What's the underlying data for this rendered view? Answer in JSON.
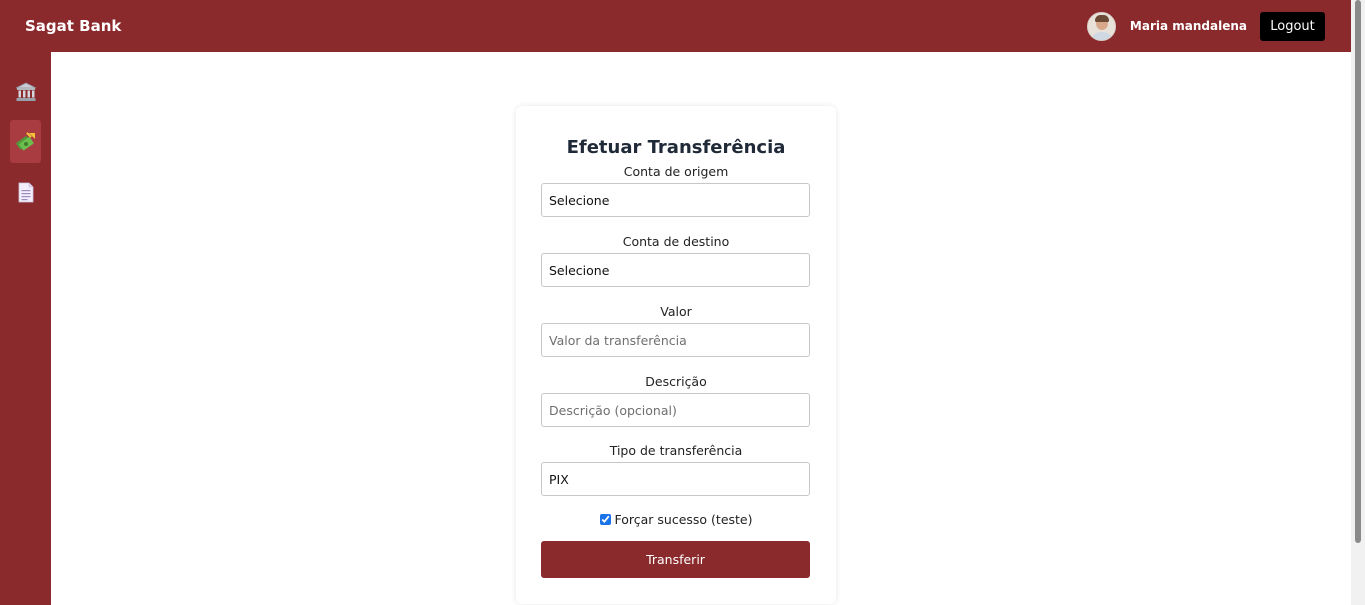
{
  "header": {
    "brand": "Sagat Bank",
    "user_name": "Maria mandalena",
    "logout_label": "Logout"
  },
  "sidebar": {
    "items": [
      {
        "icon": "bank-icon",
        "active": false
      },
      {
        "icon": "money-transfer-icon",
        "active": true
      },
      {
        "icon": "document-icon",
        "active": false
      }
    ]
  },
  "form": {
    "title": "Efetuar Transferência",
    "origin": {
      "label": "Conta de origem",
      "value": "Selecione"
    },
    "destination": {
      "label": "Conta de destino",
      "value": "Selecione"
    },
    "amount": {
      "label": "Valor",
      "placeholder": "Valor da transferência"
    },
    "description": {
      "label": "Descrição",
      "placeholder": "Descrição (opcional)"
    },
    "type": {
      "label": "Tipo de transferência",
      "value": "PIX"
    },
    "force_success": {
      "label": "Forçar sucesso (teste)",
      "checked": true
    },
    "submit_label": "Transferir"
  },
  "colors": {
    "brand": "#8b2a2d",
    "logout_bg": "#000000",
    "checkbox_accent": "#1a73e8"
  }
}
